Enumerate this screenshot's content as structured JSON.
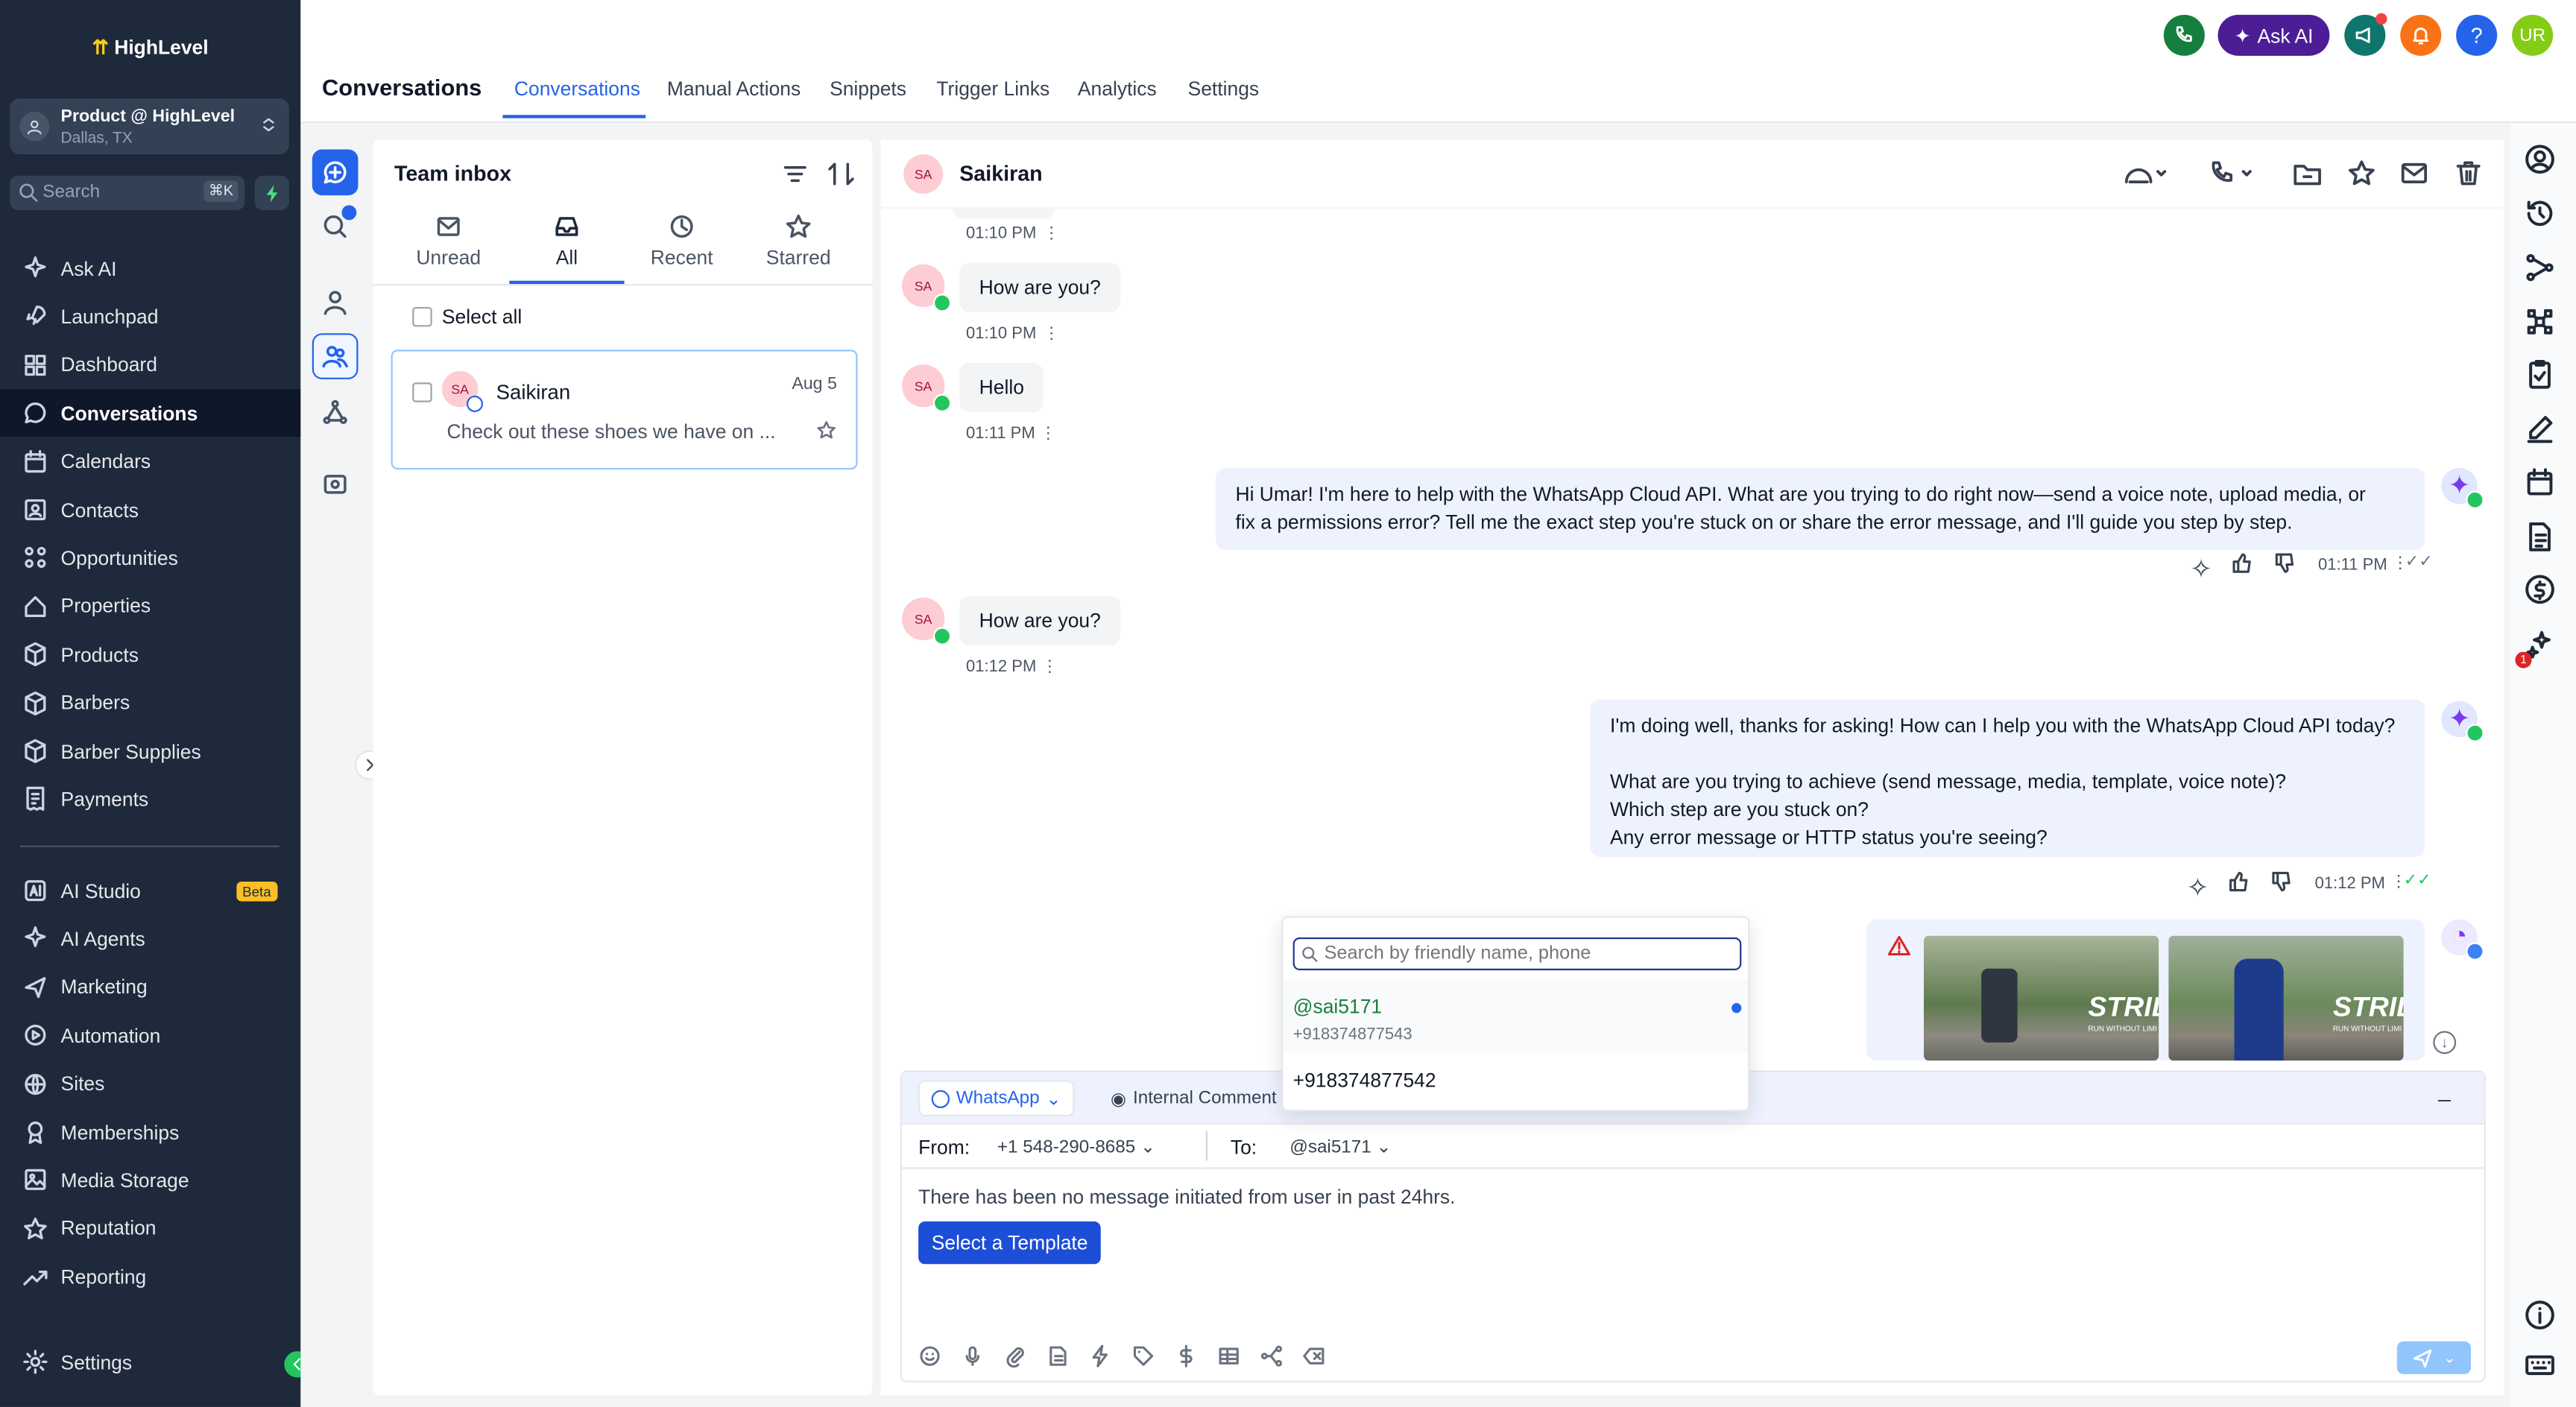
{
  "brand": {
    "logo": "HighLevel"
  },
  "location": {
    "name": "Product @ HighLevel",
    "city": "Dallas, TX"
  },
  "search": {
    "placeholder": "Search",
    "shortcut": "⌘K"
  },
  "nav": [
    {
      "label": "Ask AI",
      "icon": "sparkle-icon"
    },
    {
      "label": "Launchpad",
      "icon": "rocket-icon"
    },
    {
      "label": "Dashboard",
      "icon": "dashboard-icon"
    },
    {
      "label": "Conversations",
      "icon": "chat-icon",
      "active": true
    },
    {
      "label": "Calendars",
      "icon": "calendar-icon"
    },
    {
      "label": "Contacts",
      "icon": "contacts-icon"
    },
    {
      "label": "Opportunities",
      "icon": "opportunities-icon"
    },
    {
      "label": "Properties",
      "icon": "home-icon"
    },
    {
      "label": "Products",
      "icon": "box-icon"
    },
    {
      "label": "Barbers",
      "icon": "cube-icon"
    },
    {
      "label": "Barber Supplies",
      "icon": "cube-icon"
    },
    {
      "label": "Payments",
      "icon": "receipt-icon"
    }
  ],
  "nav2": [
    {
      "label": "AI Studio",
      "icon": "ai-studio-icon",
      "badge": "Beta"
    },
    {
      "label": "AI Agents",
      "icon": "sparkle-icon"
    },
    {
      "label": "Marketing",
      "icon": "send-icon"
    },
    {
      "label": "Automation",
      "icon": "automation-icon"
    },
    {
      "label": "Sites",
      "icon": "globe-icon"
    },
    {
      "label": "Memberships",
      "icon": "award-icon"
    },
    {
      "label": "Media Storage",
      "icon": "image-icon"
    },
    {
      "label": "Reputation",
      "icon": "star-icon"
    },
    {
      "label": "Reporting",
      "icon": "trend-icon"
    }
  ],
  "settings_label": "Settings",
  "header": {
    "title": "Conversations",
    "tabs": [
      "Conversations",
      "Manual Actions",
      "Snippets",
      "Trigger Links",
      "Analytics",
      "Settings"
    ],
    "ask_ai": "Ask AI",
    "user_initials": "UR"
  },
  "inbox": {
    "title": "Team inbox",
    "tabs": [
      "Unread",
      "All",
      "Recent",
      "Starred"
    ],
    "select_all": "Select all",
    "item": {
      "initials": "SA",
      "name": "Saikiran",
      "date": "Aug 5",
      "preview": "Check out these shoes we have on ..."
    }
  },
  "chat": {
    "contact_initials": "SA",
    "contact_name": "Saikiran",
    "messages": [
      {
        "dir": "in",
        "time": "01:10 PM"
      },
      {
        "dir": "in",
        "text": "How are you?",
        "time": "01:10 PM"
      },
      {
        "dir": "in",
        "text": "Hello",
        "time": "01:11 PM"
      },
      {
        "dir": "out",
        "lines": [
          "Hi Umar! I'm here to help with the WhatsApp Cloud API. What are you trying to do right now—send a voice note, upload media, or",
          "fix a permissions error? Tell me the exact step you're stuck on or share the error message, and I'll guide you step by step."
        ],
        "time": "01:11 PM"
      },
      {
        "dir": "in",
        "text": "How are you?",
        "time": "01:12 PM"
      },
      {
        "dir": "out",
        "lines": [
          "I'm doing well, thanks for asking! How can I help you with the WhatsApp Cloud API today?",
          "",
          "What are you trying to achieve (send message, media, template, voice note)?",
          "Which step are you stuck on?",
          "Any error message or HTTP status you're seeing?"
        ],
        "time": "01:12 PM"
      }
    ],
    "image_caption_word": "STRID",
    "image_caption_sub": "RUN WITHOUT LIMI"
  },
  "dropdown": {
    "placeholder": "Search by friendly name, phone",
    "options": [
      {
        "handle": "@sai5171",
        "phone": "+918374877543"
      },
      {
        "phone": "+918374877542"
      }
    ]
  },
  "composer": {
    "channel": "WhatsApp",
    "internal": "Internal Comment",
    "from_label": "From:",
    "from_value": "+1 548-290-8685",
    "to_label": "To:",
    "to_value": "@sai5171",
    "notice": "There has been no message initiated from user in past 24hrs.",
    "template_button": "Select a Template"
  },
  "colors": {
    "accent": "#2563eb",
    "sidebar": "#1e293b",
    "whatsapp": "#22c55e",
    "ask_ai": "#4c1d95"
  },
  "right_rail_badge": "1"
}
